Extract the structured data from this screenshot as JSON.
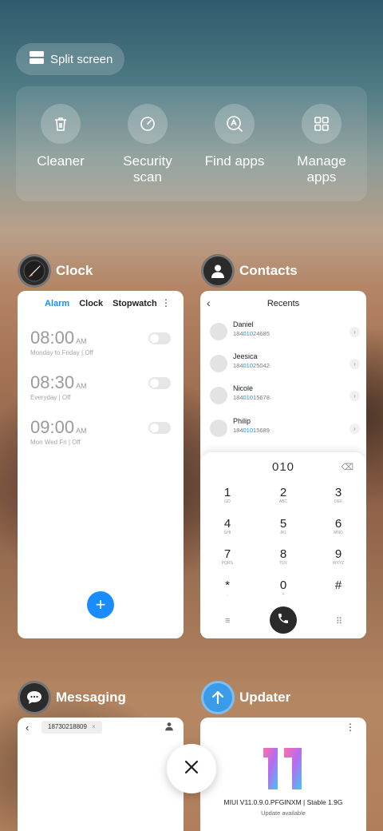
{
  "split_screen": {
    "label": "Split screen",
    "icon": "split-screen-icon"
  },
  "tools": [
    {
      "label": "Cleaner",
      "icon": "trash-icon"
    },
    {
      "label": "Security\nscan",
      "icon": "security-scan-icon"
    },
    {
      "label": "Find apps",
      "icon": "find-apps-icon"
    },
    {
      "label": "Manage\napps",
      "icon": "manage-apps-icon"
    }
  ],
  "apps": {
    "clock": {
      "name": "Clock",
      "tabs": [
        "Alarm",
        "Clock",
        "Stopwatch"
      ],
      "more": "⋮",
      "alarms": [
        {
          "time": "08:00",
          "ampm": "AM",
          "repeat": "Monday to Friday | Off"
        },
        {
          "time": "08:30",
          "ampm": "AM",
          "repeat": "Everyday | Off"
        },
        {
          "time": "09:00",
          "ampm": "AM",
          "repeat": "Mon Wed Fri | Off"
        }
      ],
      "fab": "+"
    },
    "contacts": {
      "name": "Contacts",
      "title": "Recents",
      "back": "‹",
      "recents": [
        {
          "name": "Daniel",
          "pre": "184",
          "match": "010",
          "post": "24685"
        },
        {
          "name": "Jeesica",
          "pre": "184",
          "match": "010",
          "post": "25042"
        },
        {
          "name": "Nicole",
          "pre": "184",
          "match": "010",
          "post": "15678"
        },
        {
          "name": "Philip",
          "pre": "184",
          "match": "010",
          "post": "15689"
        }
      ],
      "dial_input": "010",
      "keys": [
        {
          "d": "1",
          "l": "GD"
        },
        {
          "d": "2",
          "l": "ABC"
        },
        {
          "d": "3",
          "l": "DEF"
        },
        {
          "d": "4",
          "l": "GHI"
        },
        {
          "d": "5",
          "l": "JKL"
        },
        {
          "d": "6",
          "l": "MNO"
        },
        {
          "d": "7",
          "l": "PQRS"
        },
        {
          "d": "8",
          "l": "TUV"
        },
        {
          "d": "9",
          "l": "WXYZ"
        },
        {
          "d": "*",
          "l": ","
        },
        {
          "d": "0",
          "l": "+"
        },
        {
          "d": "#",
          "l": ""
        }
      ]
    },
    "messaging": {
      "name": "Messaging",
      "recipient": "18730218809",
      "recipient_remove": "×",
      "back": "‹"
    },
    "updater": {
      "name": "Updater",
      "more": "⋮",
      "version": "MIUI V11.0.9.0.PFGINXM | Stable 1.9G",
      "status": "Update available"
    }
  },
  "close": {
    "icon": "close-icon"
  },
  "colors": {
    "accent": "#1a8cff",
    "updater_icon": "#3a9be8"
  }
}
